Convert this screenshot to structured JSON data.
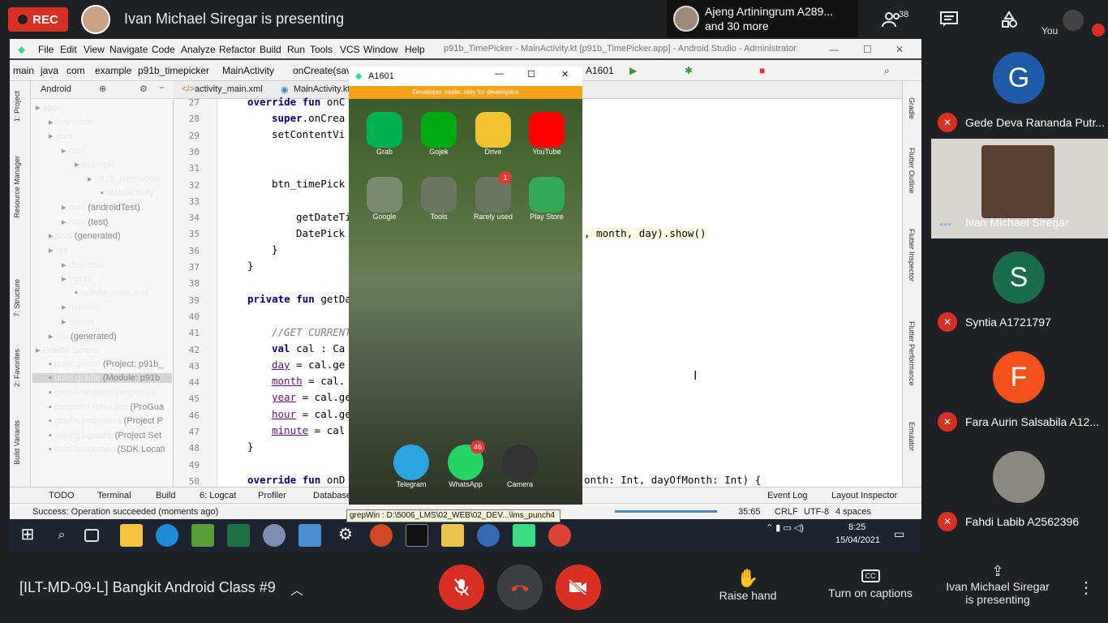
{
  "meet": {
    "rec_label": "REC",
    "presenting_title": "Ivan Michael Siregar is presenting",
    "others_line1": "Ajeng Artiningrum A289...",
    "others_line2": "and 30 more",
    "participant_count": "38",
    "you_label": "You",
    "meeting_title": "[ILT-MD-09-L] Bangkit Android Class #9",
    "raise_hand": "Raise hand",
    "captions": "Turn on captions",
    "presenter_line1": "Ivan Michael Siregar",
    "presenter_line2": "is presenting"
  },
  "participants": [
    {
      "initial": "G",
      "name": "Gede Deva Rananda Putr...",
      "color": "#1e5aa8",
      "muted": true
    },
    {
      "initial": "",
      "name": "Ivan Michael Siregar",
      "color": "#d8d6d0",
      "muted": false
    },
    {
      "initial": "S",
      "name": "Syntia A1721797",
      "color": "#176d4c",
      "muted": true
    },
    {
      "initial": "F",
      "name": "Fara Aurin Salsabila A12...",
      "color": "#f4511e",
      "muted": true
    },
    {
      "initial": "",
      "name": "Fahdi Labib A2562396",
      "color": "#8c8a80",
      "muted": true
    }
  ],
  "studio": {
    "window_title": "p91b_TimePicker - MainActivity.kt [p91b_TimePicker.app] - Android Studio - Administrator",
    "menu": [
      "File",
      "Edit",
      "View",
      "Navigate",
      "Code",
      "Analyze",
      "Refactor",
      "Build",
      "Run",
      "Tools",
      "VCS",
      "Window",
      "Help"
    ],
    "breadcrumb": [
      "main",
      "java",
      "com",
      "example",
      "p91b_timepicker",
      "MainActivity",
      "onCreate(saved"
    ],
    "device": "A1601",
    "panel_label": "Android",
    "tabs": [
      "activity_main.xml",
      "MainActivity.kt"
    ],
    "tree": [
      {
        "t": "app",
        "g": "",
        "d": 0,
        "b": true
      },
      {
        "t": "manifests",
        "g": "",
        "d": 1
      },
      {
        "t": "java",
        "g": "",
        "d": 1
      },
      {
        "t": "com",
        "g": "",
        "d": 2
      },
      {
        "t": "example",
        "g": "",
        "d": 3
      },
      {
        "t": "p91b_timepicker",
        "g": "",
        "d": 4
      },
      {
        "t": "MainActivity",
        "g": "",
        "d": 5
      },
      {
        "t": "com",
        "g": " (androidTest)",
        "d": 2
      },
      {
        "t": "com",
        "g": " (test)",
        "d": 2
      },
      {
        "t": "java",
        "g": " (generated)",
        "d": 1
      },
      {
        "t": "res",
        "g": "",
        "d": 1
      },
      {
        "t": "drawable",
        "g": "",
        "d": 2
      },
      {
        "t": "layout",
        "g": "",
        "d": 2
      },
      {
        "t": "activity_main.xml",
        "g": "",
        "d": 3
      },
      {
        "t": "mipmap",
        "g": "",
        "d": 2
      },
      {
        "t": "values",
        "g": "",
        "d": 2
      },
      {
        "t": "res",
        "g": " (generated)",
        "d": 1
      },
      {
        "t": "Gradle Scripts",
        "g": "",
        "d": 0
      },
      {
        "t": "build.gradle",
        "g": " (Project: p91b_",
        "d": 1
      },
      {
        "t": "build.gradle",
        "g": " (Module: p91b",
        "d": 1
      },
      {
        "t": "gradle-wrapper.properties",
        "g": "",
        "d": 1
      },
      {
        "t": "proguard-rules.pro",
        "g": " (ProGua",
        "d": 1
      },
      {
        "t": "gradle.properties",
        "g": " (Project P",
        "d": 1
      },
      {
        "t": "settings.gradle",
        "g": " (Project Set",
        "d": 1
      },
      {
        "t": "local.properties",
        "g": " (SDK Locati",
        "d": 1
      }
    ],
    "lines": [
      "27",
      "28",
      "29",
      "30",
      "31",
      "32",
      "33",
      "34",
      "35",
      "36",
      "37",
      "38",
      "39",
      "40",
      "41",
      "42",
      "43",
      "44",
      "45",
      "46",
      "47",
      "48",
      "49",
      "50"
    ],
    "code_right": ", month, day).show()",
    "code_bottom_right": "onth: Int, dayOfMonth: Int) {",
    "bottom_tools": [
      "TODO",
      "Terminal",
      "Build",
      "6: Logcat",
      "Profiler",
      "Database"
    ],
    "bottom_tools_right": [
      "Event Log",
      "Layout Inspector"
    ],
    "status_msg": "Success: Operation succeeded (moments ago)",
    "status_pos": "35:65",
    "status_crlf": "CRLF",
    "status_enc": "UTF-8",
    "status_indent": "4 spaces",
    "tooltip": "grepWin : D:\\5006_LMS\\02_WEB\\02_DEV...\\lms_punch4",
    "clock_time": "8:25",
    "clock_date": "15/04/2021",
    "right_tools": [
      "Gradle",
      "Flutter Outline",
      "Flutter Inspector",
      "Flutter Performance",
      "Emulator"
    ],
    "left_tools": [
      "1: Project",
      "Resource Manager",
      "7: Structure",
      "2: Favorites",
      "Build Variants"
    ]
  },
  "emulator": {
    "title": "A1601",
    "dev_banner": "Developer mode: only for developers",
    "apps": [
      {
        "label": "Grab",
        "color": "#00b14f"
      },
      {
        "label": "Gojek",
        "color": "#00aa13"
      },
      {
        "label": "Drive",
        "color": "#f1c232"
      },
      {
        "label": "YouTube",
        "color": "#ff0000"
      },
      {
        "label": "Google",
        "color": "#7a8a6e"
      },
      {
        "label": "Tools",
        "color": "#6c7560"
      },
      {
        "label": "Rarely used",
        "color": "#6c7560"
      },
      {
        "label": "Play Store",
        "color": "#34a853"
      }
    ],
    "dock": [
      {
        "label": "Telegram",
        "color": "#2ca5e0"
      },
      {
        "label": "WhatsApp",
        "color": "#25d366"
      },
      {
        "label": "Camera",
        "color": "#333333"
      }
    ],
    "whatsapp_badge": "46",
    "folder_badge": "1"
  }
}
